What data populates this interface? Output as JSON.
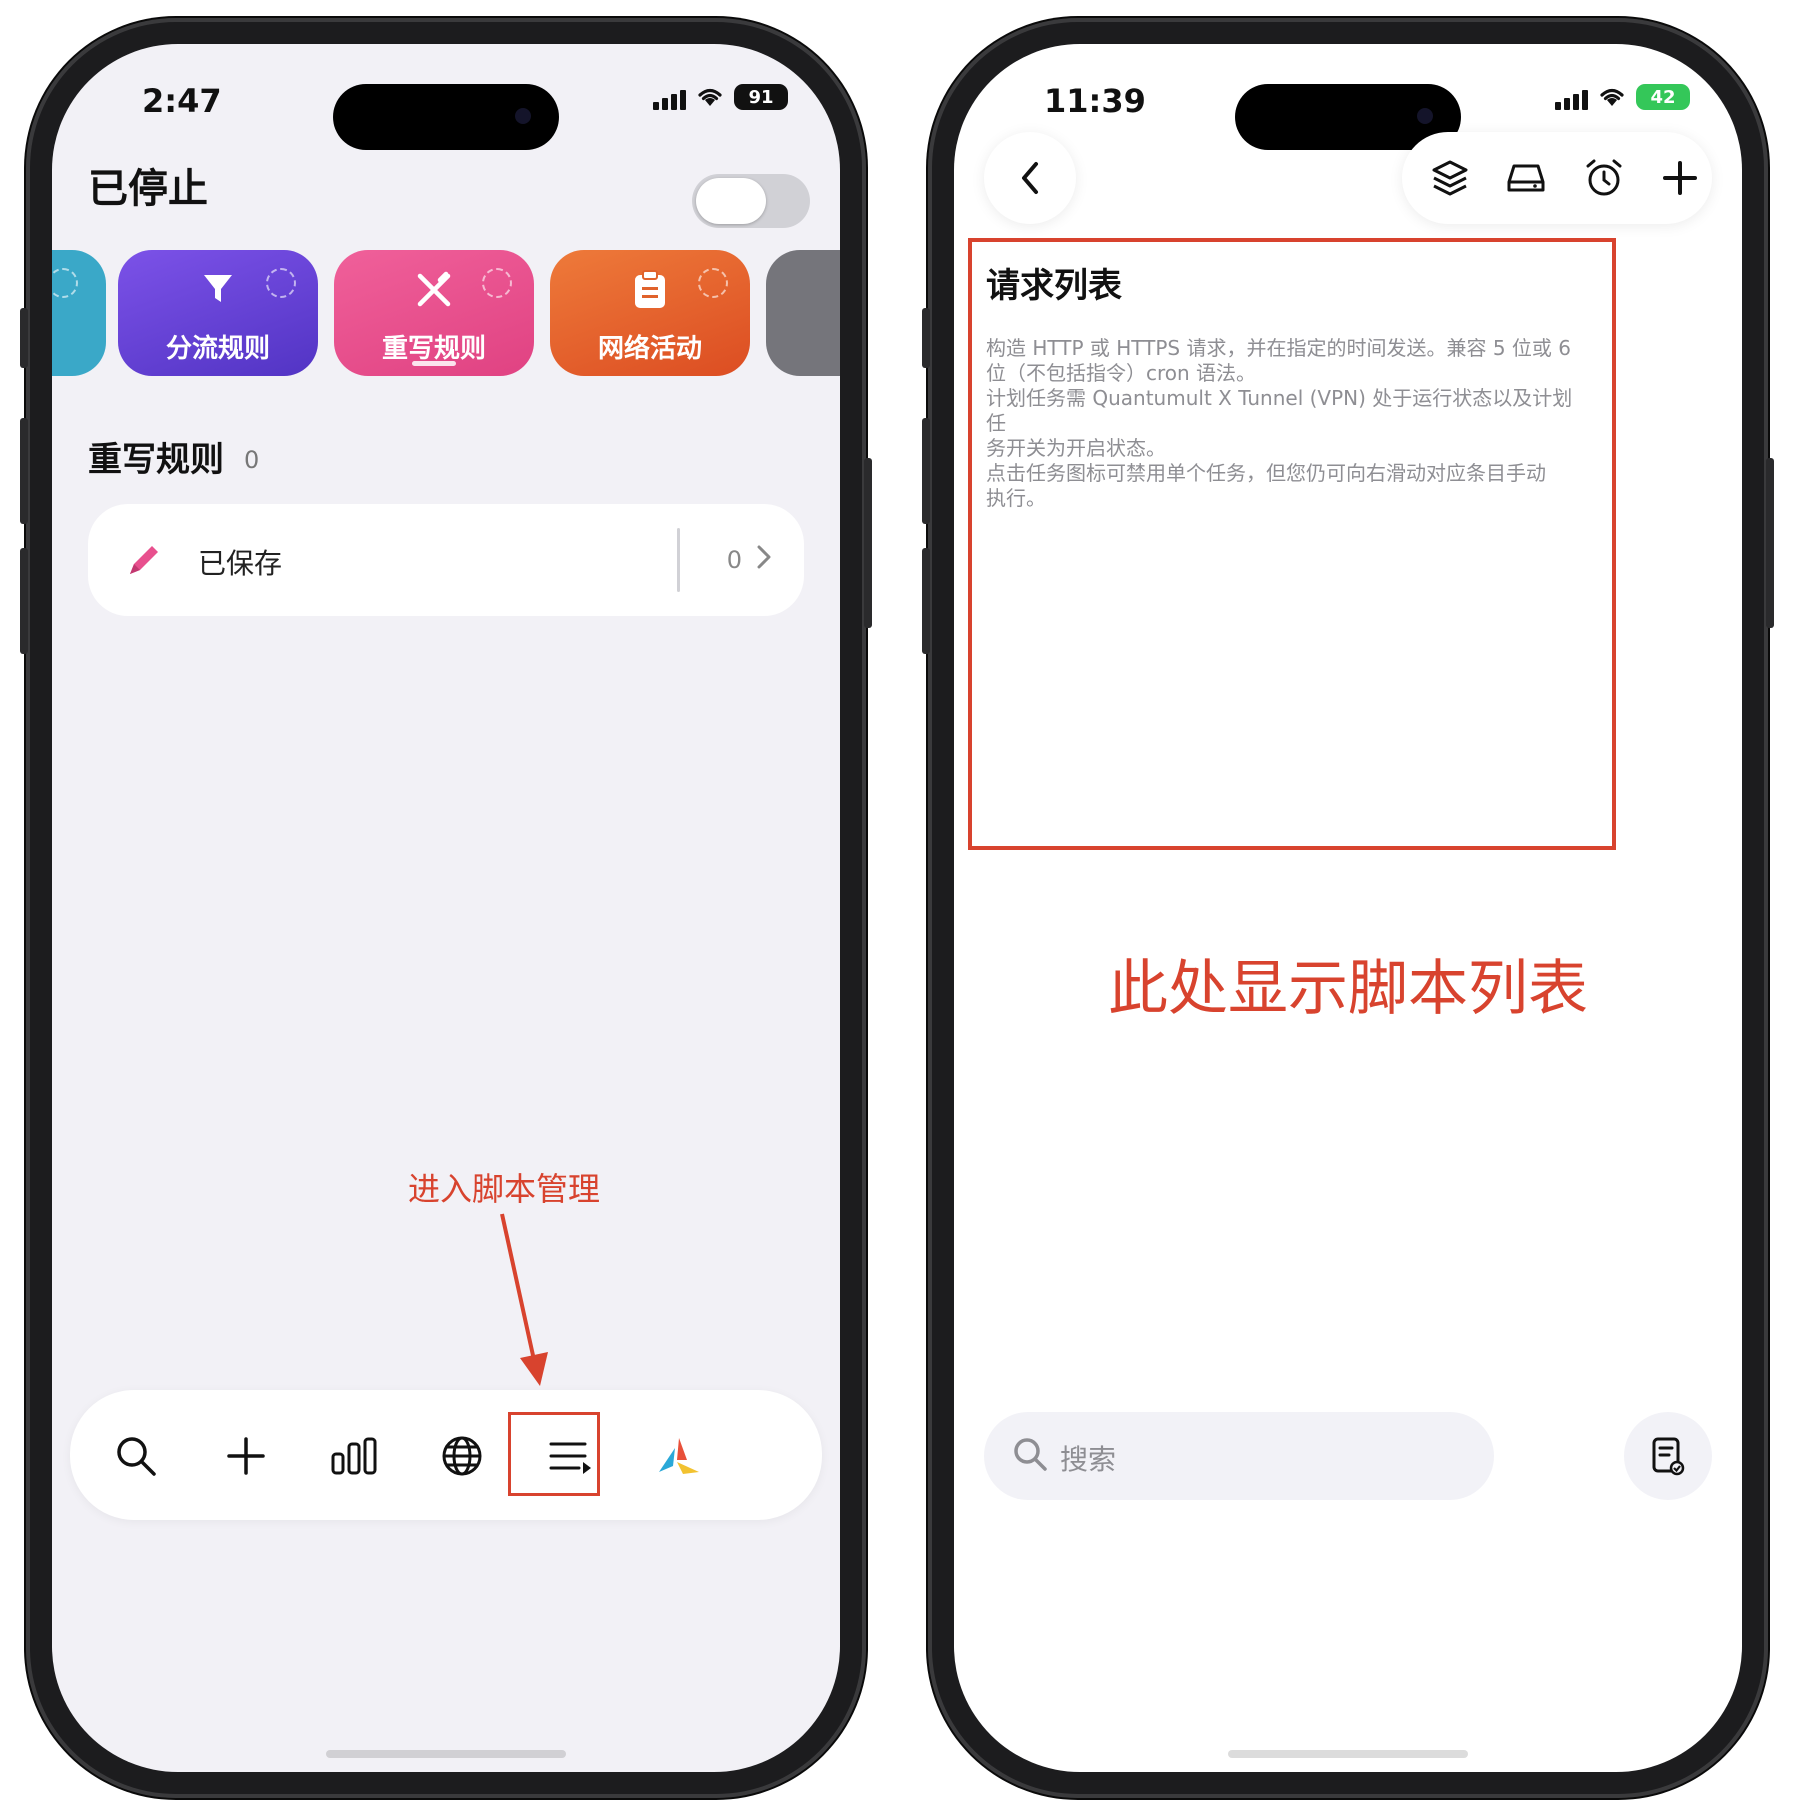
{
  "left_phone": {
    "status": {
      "time": "2:47",
      "battery": "91"
    },
    "title": "已停止",
    "tiles": [
      {
        "label": "分流规则",
        "icon": "filter-icon",
        "color": "#6a45d8"
      },
      {
        "label": "重写规则",
        "icon": "rewrite-icon",
        "color": "#e8508e"
      },
      {
        "label": "网络活动",
        "icon": "clipboard-icon",
        "color": "#e0622b"
      }
    ],
    "section": {
      "title": "重写规则",
      "count": "0"
    },
    "saved": {
      "label": "已保存",
      "count": "0"
    },
    "annotation": "进入脚本管理",
    "bottom_tabs": [
      "search-icon",
      "add-icon",
      "stats-icon",
      "globe-icon",
      "script-list-icon",
      "app-logo-icon"
    ]
  },
  "right_phone": {
    "status": {
      "time": "11:39",
      "battery": "42"
    },
    "toolbar_icons": [
      "layers-icon",
      "drive-icon",
      "alarm-icon",
      "add-icon"
    ],
    "info": {
      "title": "请求列表",
      "body": "构造 HTTP 或 HTTPS 请求，并在指定的时间发送。兼容 5 位或 6\n位（不包括指令）cron 语法。\n计划任务需 Quantumult X Tunnel (VPN) 处于运行状态以及计划任\n务开关为开启状态。\n点击任务图标可禁用单个任务，但您仍可向右滑动对应条目手动\n执行。"
    },
    "annotation": "此处显示脚本列表",
    "search_placeholder": "搜索"
  },
  "colors": {
    "accent_red": "#d8432e"
  }
}
